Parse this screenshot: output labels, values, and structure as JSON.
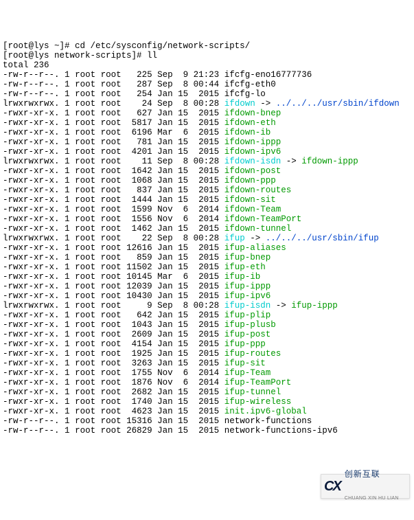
{
  "prompt1": {
    "user_host": "[root@lys ~]# ",
    "cmd": "cd /etc/sysconfig/network-scripts/"
  },
  "prompt2": {
    "user_host": "[root@lys network-scripts]# ",
    "cmd": "ll"
  },
  "total": "total 236",
  "rows": [
    {
      "perm": "-rw-r--r--.",
      "links": "1",
      "owner": "root",
      "group": "root",
      "size": "225",
      "date": "Sep  9 21:23",
      "name": "ifcfg-eno16777736",
      "cls": "file"
    },
    {
      "perm": "-rw-r--r--.",
      "links": "1",
      "owner": "root",
      "group": "root",
      "size": "287",
      "date": "Sep  8 00:44",
      "name": "ifcfg-eth0",
      "cls": "file"
    },
    {
      "perm": "-rw-r--r--.",
      "links": "1",
      "owner": "root",
      "group": "root",
      "size": "254",
      "date": "Jan 15  2015",
      "name": "ifcfg-lo",
      "cls": "file"
    },
    {
      "perm": "lrwxrwxrwx.",
      "links": "1",
      "owner": "root",
      "group": "root",
      "size": "24",
      "date": "Sep  8 00:28",
      "name": "ifdown",
      "cls": "link",
      "arrow": " -> ",
      "target": "../../../usr/sbin/ifdown",
      "tcls": "target"
    },
    {
      "perm": "-rwxr-xr-x.",
      "links": "1",
      "owner": "root",
      "group": "root",
      "size": "627",
      "date": "Jan 15  2015",
      "name": "ifdown-bnep",
      "cls": "exe"
    },
    {
      "perm": "-rwxr-xr-x.",
      "links": "1",
      "owner": "root",
      "group": "root",
      "size": "5817",
      "date": "Jan 15  2015",
      "name": "ifdown-eth",
      "cls": "exe"
    },
    {
      "perm": "-rwxr-xr-x.",
      "links": "1",
      "owner": "root",
      "group": "root",
      "size": "6196",
      "date": "Mar  6  2015",
      "name": "ifdown-ib",
      "cls": "exe"
    },
    {
      "perm": "-rwxr-xr-x.",
      "links": "1",
      "owner": "root",
      "group": "root",
      "size": "781",
      "date": "Jan 15  2015",
      "name": "ifdown-ippp",
      "cls": "exe"
    },
    {
      "perm": "-rwxr-xr-x.",
      "links": "1",
      "owner": "root",
      "group": "root",
      "size": "4201",
      "date": "Jan 15  2015",
      "name": "ifdown-ipv6",
      "cls": "exe"
    },
    {
      "perm": "lrwxrwxrwx.",
      "links": "1",
      "owner": "root",
      "group": "root",
      "size": "11",
      "date": "Sep  8 00:28",
      "name": "ifdown-isdn",
      "cls": "link",
      "arrow": " -> ",
      "target": "ifdown-ippp",
      "tcls": "exe"
    },
    {
      "perm": "-rwxr-xr-x.",
      "links": "1",
      "owner": "root",
      "group": "root",
      "size": "1642",
      "date": "Jan 15  2015",
      "name": "ifdown-post",
      "cls": "exe"
    },
    {
      "perm": "-rwxr-xr-x.",
      "links": "1",
      "owner": "root",
      "group": "root",
      "size": "1068",
      "date": "Jan 15  2015",
      "name": "ifdown-ppp",
      "cls": "exe"
    },
    {
      "perm": "-rwxr-xr-x.",
      "links": "1",
      "owner": "root",
      "group": "root",
      "size": "837",
      "date": "Jan 15  2015",
      "name": "ifdown-routes",
      "cls": "exe"
    },
    {
      "perm": "-rwxr-xr-x.",
      "links": "1",
      "owner": "root",
      "group": "root",
      "size": "1444",
      "date": "Jan 15  2015",
      "name": "ifdown-sit",
      "cls": "exe"
    },
    {
      "perm": "-rwxr-xr-x.",
      "links": "1",
      "owner": "root",
      "group": "root",
      "size": "1599",
      "date": "Nov  6  2014",
      "name": "ifdown-Team",
      "cls": "exe"
    },
    {
      "perm": "-rwxr-xr-x.",
      "links": "1",
      "owner": "root",
      "group": "root",
      "size": "1556",
      "date": "Nov  6  2014",
      "name": "ifdown-TeamPort",
      "cls": "exe"
    },
    {
      "perm": "-rwxr-xr-x.",
      "links": "1",
      "owner": "root",
      "group": "root",
      "size": "1462",
      "date": "Jan 15  2015",
      "name": "ifdown-tunnel",
      "cls": "exe"
    },
    {
      "perm": "lrwxrwxrwx.",
      "links": "1",
      "owner": "root",
      "group": "root",
      "size": "22",
      "date": "Sep  8 00:28",
      "name": "ifup",
      "cls": "link",
      "arrow": " -> ",
      "target": "../../../usr/sbin/ifup",
      "tcls": "target"
    },
    {
      "perm": "-rwxr-xr-x.",
      "links": "1",
      "owner": "root",
      "group": "root",
      "size": "12616",
      "date": "Jan 15  2015",
      "name": "ifup-aliases",
      "cls": "exe"
    },
    {
      "perm": "-rwxr-xr-x.",
      "links": "1",
      "owner": "root",
      "group": "root",
      "size": "859",
      "date": "Jan 15  2015",
      "name": "ifup-bnep",
      "cls": "exe"
    },
    {
      "perm": "-rwxr-xr-x.",
      "links": "1",
      "owner": "root",
      "group": "root",
      "size": "11502",
      "date": "Jan 15  2015",
      "name": "ifup-eth",
      "cls": "exe"
    },
    {
      "perm": "-rwxr-xr-x.",
      "links": "1",
      "owner": "root",
      "group": "root",
      "size": "10145",
      "date": "Mar  6  2015",
      "name": "ifup-ib",
      "cls": "exe"
    },
    {
      "perm": "-rwxr-xr-x.",
      "links": "1",
      "owner": "root",
      "group": "root",
      "size": "12039",
      "date": "Jan 15  2015",
      "name": "ifup-ippp",
      "cls": "exe"
    },
    {
      "perm": "-rwxr-xr-x.",
      "links": "1",
      "owner": "root",
      "group": "root",
      "size": "10430",
      "date": "Jan 15  2015",
      "name": "ifup-ipv6",
      "cls": "exe"
    },
    {
      "perm": "lrwxrwxrwx.",
      "links": "1",
      "owner": "root",
      "group": "root",
      "size": "9",
      "date": "Sep  8 00:28",
      "name": "ifup-isdn",
      "cls": "link",
      "arrow": " -> ",
      "target": "ifup-ippp",
      "tcls": "exe"
    },
    {
      "perm": "-rwxr-xr-x.",
      "links": "1",
      "owner": "root",
      "group": "root",
      "size": "642",
      "date": "Jan 15  2015",
      "name": "ifup-plip",
      "cls": "exe"
    },
    {
      "perm": "-rwxr-xr-x.",
      "links": "1",
      "owner": "root",
      "group": "root",
      "size": "1043",
      "date": "Jan 15  2015",
      "name": "ifup-plusb",
      "cls": "exe"
    },
    {
      "perm": "-rwxr-xr-x.",
      "links": "1",
      "owner": "root",
      "group": "root",
      "size": "2609",
      "date": "Jan 15  2015",
      "name": "ifup-post",
      "cls": "exe"
    },
    {
      "perm": "-rwxr-xr-x.",
      "links": "1",
      "owner": "root",
      "group": "root",
      "size": "4154",
      "date": "Jan 15  2015",
      "name": "ifup-ppp",
      "cls": "exe"
    },
    {
      "perm": "-rwxr-xr-x.",
      "links": "1",
      "owner": "root",
      "group": "root",
      "size": "1925",
      "date": "Jan 15  2015",
      "name": "ifup-routes",
      "cls": "exe"
    },
    {
      "perm": "-rwxr-xr-x.",
      "links": "1",
      "owner": "root",
      "group": "root",
      "size": "3263",
      "date": "Jan 15  2015",
      "name": "ifup-sit",
      "cls": "exe"
    },
    {
      "perm": "-rwxr-xr-x.",
      "links": "1",
      "owner": "root",
      "group": "root",
      "size": "1755",
      "date": "Nov  6  2014",
      "name": "ifup-Team",
      "cls": "exe"
    },
    {
      "perm": "-rwxr-xr-x.",
      "links": "1",
      "owner": "root",
      "group": "root",
      "size": "1876",
      "date": "Nov  6  2014",
      "name": "ifup-TeamPort",
      "cls": "exe"
    },
    {
      "perm": "-rwxr-xr-x.",
      "links": "1",
      "owner": "root",
      "group": "root",
      "size": "2682",
      "date": "Jan 15  2015",
      "name": "ifup-tunnel",
      "cls": "exe"
    },
    {
      "perm": "-rwxr-xr-x.",
      "links": "1",
      "owner": "root",
      "group": "root",
      "size": "1740",
      "date": "Jan 15  2015",
      "name": "ifup-wireless",
      "cls": "exe"
    },
    {
      "perm": "-rwxr-xr-x.",
      "links": "1",
      "owner": "root",
      "group": "root",
      "size": "4623",
      "date": "Jan 15  2015",
      "name": "init.ipv6-global",
      "cls": "exe"
    },
    {
      "perm": "-rw-r--r--.",
      "links": "1",
      "owner": "root",
      "group": "root",
      "size": "15316",
      "date": "Jan 15  2015",
      "name": "network-functions",
      "cls": "file"
    },
    {
      "perm": "-rw-r--r--.",
      "links": "1",
      "owner": "root",
      "group": "root",
      "size": "26829",
      "date": "Jan 15  2015",
      "name": "network-functions-ipv6",
      "cls": "file"
    }
  ],
  "badge": {
    "code": "CX",
    "zh": "创新互联",
    "py": "CHUANG XIN HU LIAN"
  }
}
